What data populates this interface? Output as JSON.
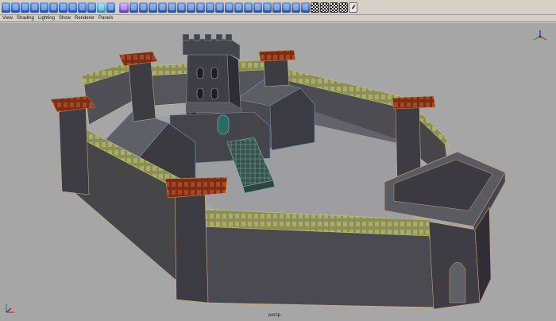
{
  "menu": {
    "items": [
      "View",
      "Shading",
      "Lighting",
      "Show",
      "Renderer",
      "Panels"
    ]
  },
  "shelf": {
    "icons": [
      "sphere-icon",
      "cube-icon",
      "cylinder-icon",
      "cone-icon",
      "plane-icon",
      "torus-icon",
      "prism-icon",
      "pyramid-icon",
      "pipe-icon",
      "helix-icon",
      "soccer-ball-icon",
      "subdiv-sphere-icon",
      "subdiv-cube-icon",
      "nurbs-sphere-icon",
      "combine-icon",
      "separate-icon",
      "extract-icon",
      "smooth-icon",
      "bevel-icon",
      "extrude-face-icon",
      "extrude-edge-icon",
      "bridge-icon",
      "append-polygon-icon",
      "split-polygon-icon",
      "insert-edge-loop-icon",
      "merge-vertices-icon",
      "merge-edge-icon",
      "collapse-icon",
      "delete-edge-icon",
      "wedge-face-icon",
      "poke-face-icon",
      "duplicate-face-icon",
      "checker-uv-icon",
      "checker-map-icon",
      "checker-layout-icon",
      "checker-grid-icon",
      "pencil-icon"
    ]
  },
  "viewport": {
    "camera": "persp",
    "background": "#a6a6a6"
  }
}
